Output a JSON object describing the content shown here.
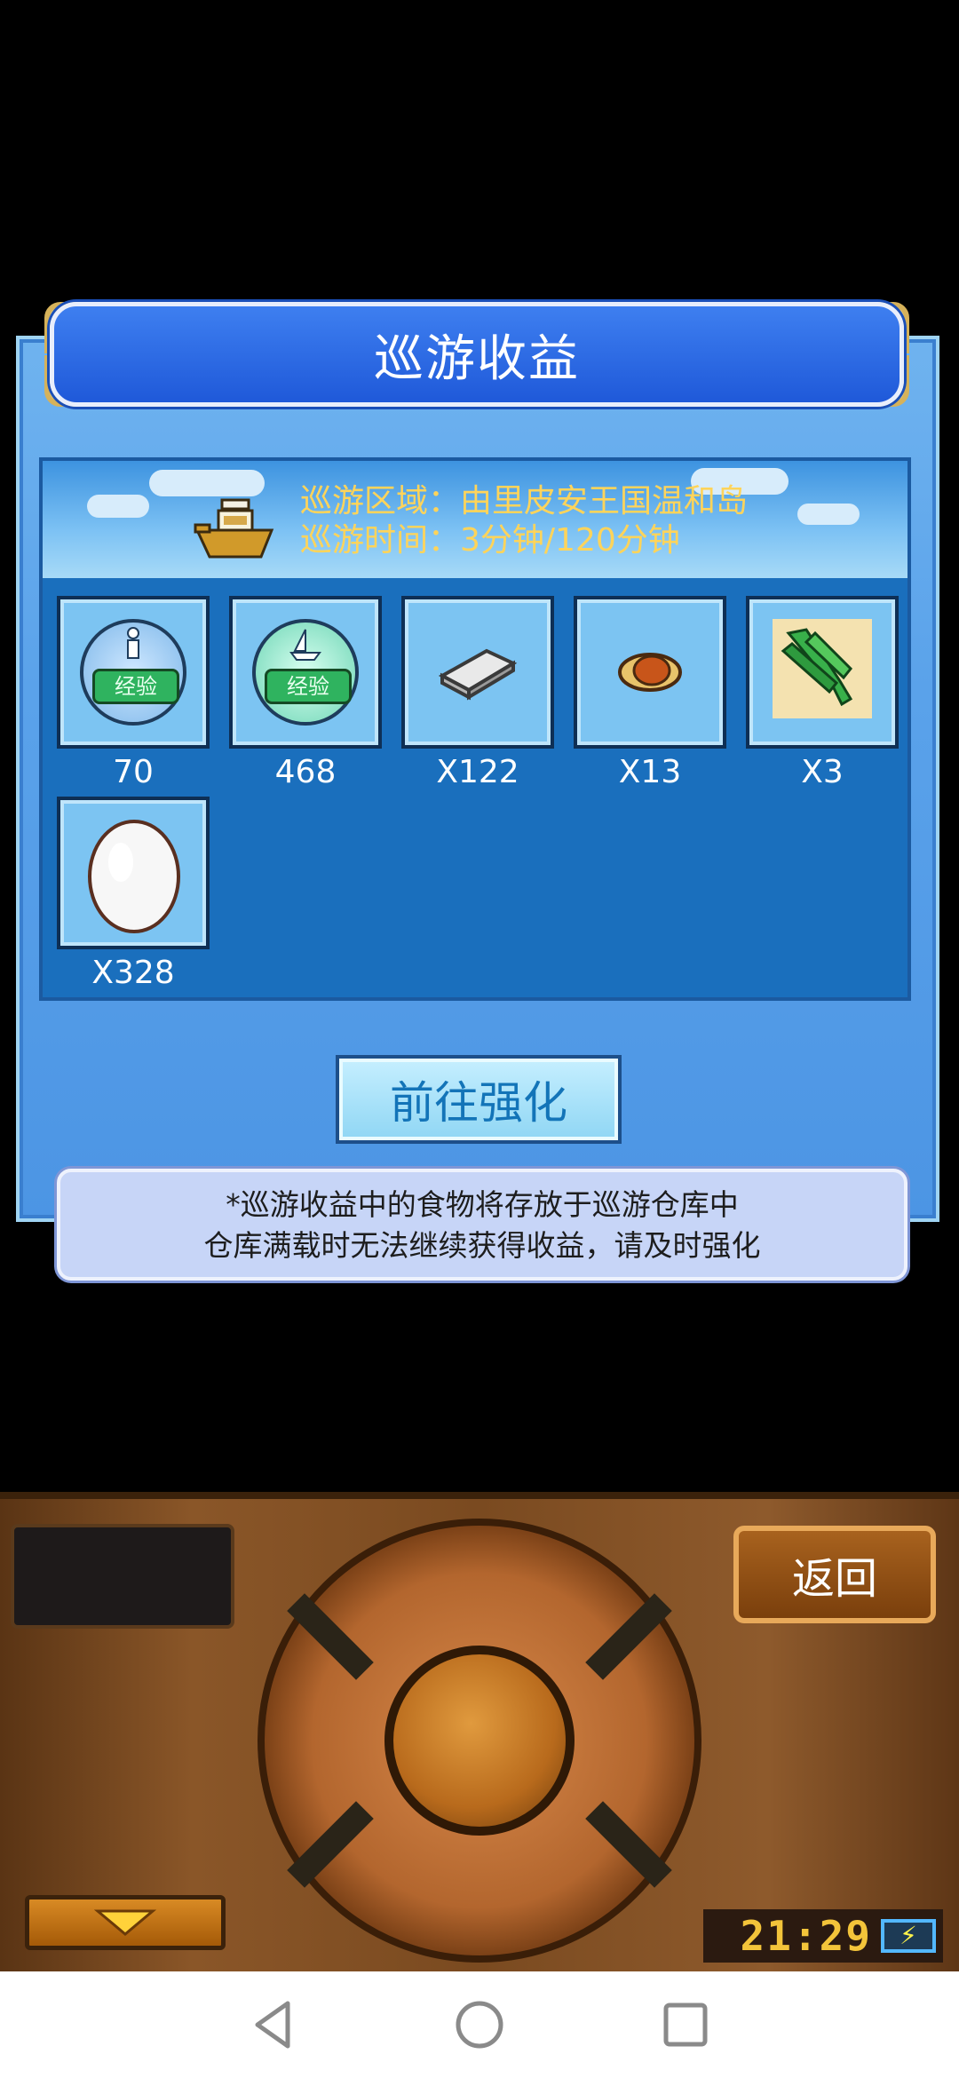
{
  "dialog": {
    "title": "巡游收益",
    "region_line": "巡游区域：由里皮安王国温和岛",
    "time_line": "巡游时间：3分钟/120分钟",
    "go_button": "前往强化",
    "note_line1": "*巡游收益中的食物将存放于巡游仓库中",
    "note_line2": "仓库满载时无法继续获得收益，请及时强化"
  },
  "rewards": [
    {
      "icon": "staff-exp-icon",
      "label": "70"
    },
    {
      "icon": "boat-exp-icon",
      "label": "468"
    },
    {
      "icon": "silver-bar-icon",
      "label": "X122"
    },
    {
      "icon": "roast-meat-icon",
      "label": "X13"
    },
    {
      "icon": "leek-icon",
      "label": "X3"
    },
    {
      "icon": "egg-icon",
      "label": "X328"
    }
  ],
  "exp_tag_text": "经验",
  "console": {
    "back_button": "返回",
    "clock": "21:29",
    "battery_icon": "charging-battery-icon"
  },
  "navbar": {
    "back": "back-triangle-icon",
    "home": "home-circle-icon",
    "recents": "recents-square-icon"
  }
}
